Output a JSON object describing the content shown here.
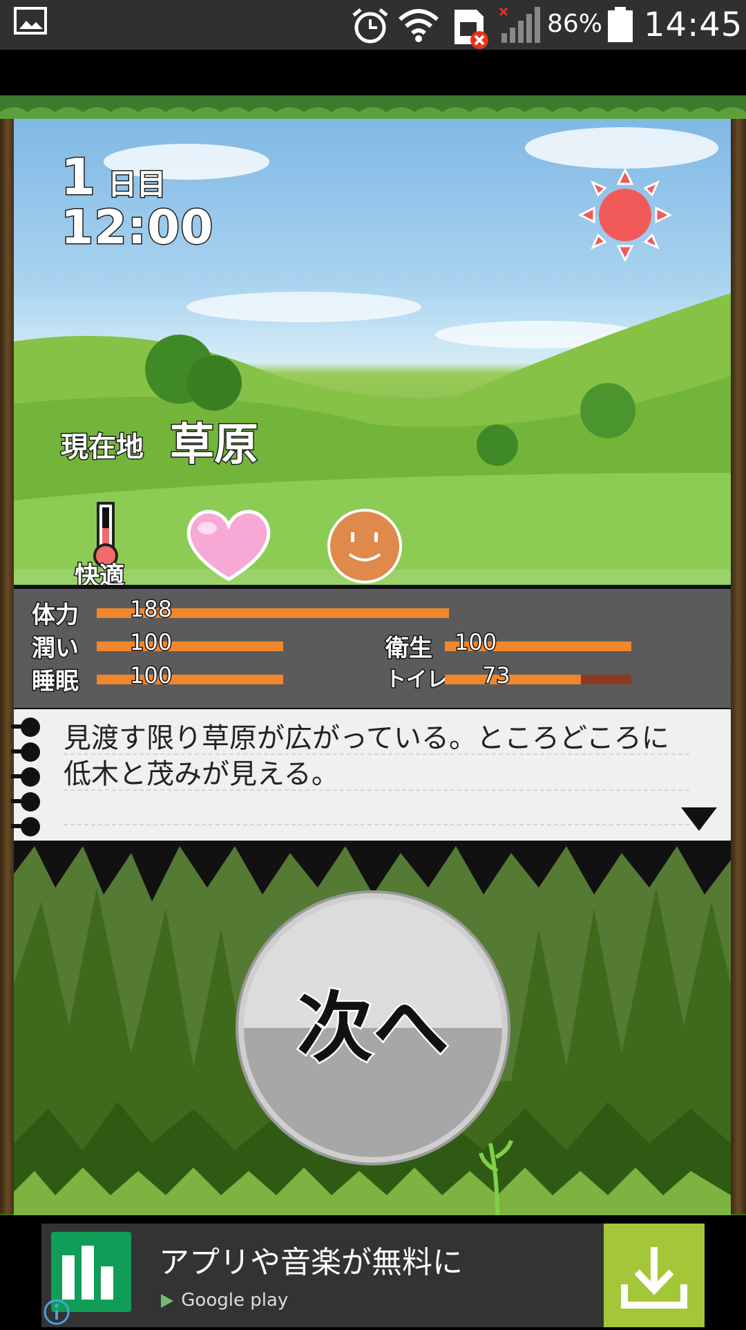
{
  "status_bar": {
    "battery": "86%",
    "time": "14:45",
    "icons": [
      "gallery-icon",
      "alarm-icon",
      "wifi-icon",
      "sim-error-icon",
      "signal-icon",
      "battery-icon"
    ]
  },
  "game": {
    "day_number": "1",
    "day_unit": "日目",
    "time": "12:00",
    "location_label": "現在地",
    "location_value": "草原",
    "comfort_label": "快適",
    "weather_icon": "sun-icon",
    "mood_icons": [
      "thermometer-icon",
      "heart-icon",
      "smiley-face-icon"
    ]
  },
  "stats": [
    {
      "name": "体力",
      "value": "188",
      "fraction": 1.0
    },
    {
      "name": "潤い",
      "value": "100",
      "fraction": 1.0
    },
    {
      "name": "睡眠",
      "value": "100",
      "fraction": 1.0
    },
    {
      "name": "衛生",
      "value": "100",
      "fraction": 1.0
    },
    {
      "name": "トイレ",
      "value": "73",
      "fraction": 0.73
    }
  ],
  "message": {
    "text": "見渡す限り草原が広がっている。ところどころに低木と茂みが見える。"
  },
  "next_button": {
    "label": "次へ"
  },
  "ad": {
    "headline": "アプリや音楽が無料に",
    "store": "Google play",
    "download_icon": "download-icon",
    "info_icon": "info-icon"
  },
  "colors": {
    "stat_bar": "#f0872c",
    "sun": "#f25a5a",
    "heart": "#f7a8d4",
    "face": "#e0894c",
    "ad_accent": "#a4c639"
  }
}
